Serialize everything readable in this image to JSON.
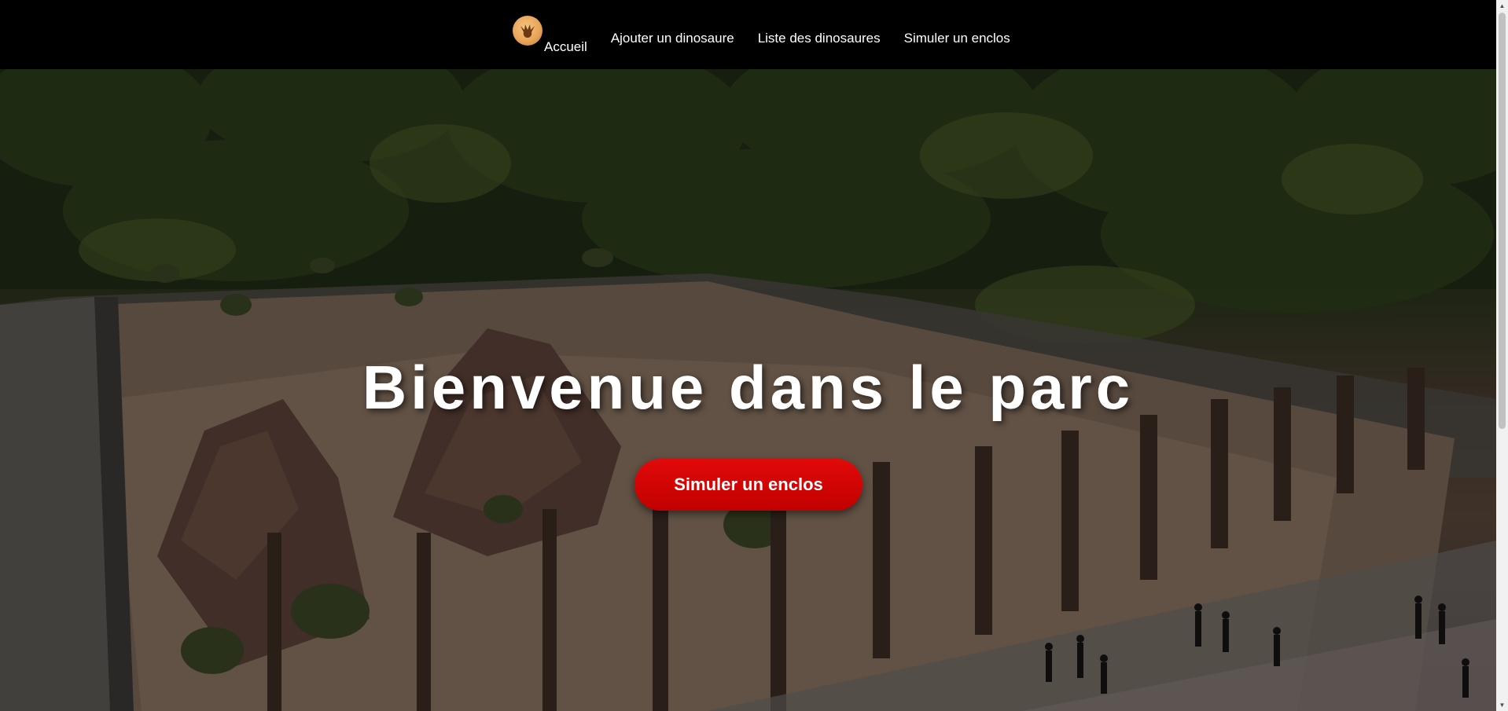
{
  "nav": {
    "logo_icon": "dino-footprint-icon",
    "home_label": "Accueil",
    "links": [
      {
        "label": "Ajouter un dinosaure"
      },
      {
        "label": "Liste des dinosaures"
      },
      {
        "label": "Simuler un enclos"
      }
    ]
  },
  "hero": {
    "title": "Bienvenue dans le parc",
    "button_label": "Simuler un enclos",
    "button_color": "#d10000"
  },
  "colors": {
    "navbar_bg": "#000000",
    "text": "#ffffff"
  }
}
